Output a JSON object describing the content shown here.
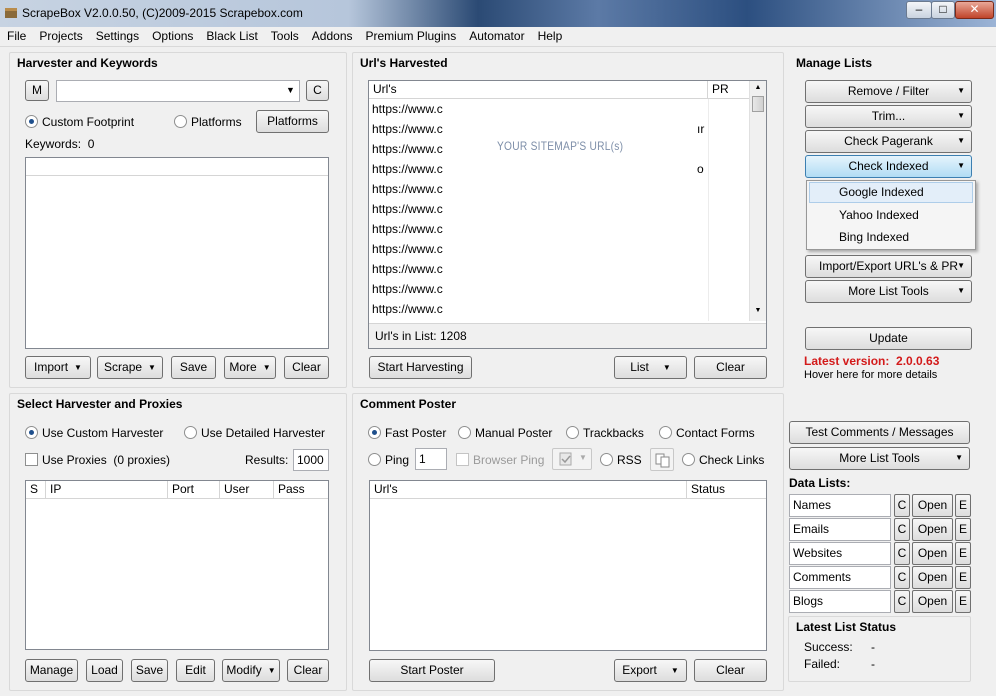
{
  "window": {
    "title": "ScrapeBox V2.0.0.50, (C)2009-2015 Scrapebox.com",
    "minimize": "–",
    "maximize": "□",
    "close": "✕"
  },
  "menu": [
    "File",
    "Projects",
    "Settings",
    "Options",
    "Black List",
    "Tools",
    "Addons",
    "Premium Plugins",
    "Automator",
    "Help"
  ],
  "harvester": {
    "title": "Harvester and Keywords",
    "m_button": "M",
    "c_button": "C",
    "footprint_value": "",
    "custom_footprint_label": "Custom Footprint",
    "platforms_radio_label": "Platforms",
    "platforms_button": "Platforms",
    "keywords_label": "Keywords:",
    "keywords_count": "0",
    "buttons": {
      "import": "Import",
      "scrape": "Scrape",
      "save": "Save",
      "more": "More",
      "clear": "Clear"
    }
  },
  "urls": {
    "title": "Url's Harvested",
    "col_url": "Url's",
    "col_pr": "PR",
    "rows": [
      "https://www.c",
      "https://www.c",
      "https://www.c",
      "https://www.c",
      "https://www.c",
      "https://www.c",
      "https://www.c",
      "https://www.c",
      "https://www.c",
      "https://www.c",
      "https://www.c"
    ],
    "row_tails": [
      "",
      "ır",
      "",
      "o",
      "",
      "",
      "",
      "",
      "",
      "",
      ""
    ],
    "overlay_text": "YOUR SITEMAP'S URL(s)",
    "count_label": "Url's in List:",
    "count": "1208",
    "buttons": {
      "start": "Start Harvesting",
      "list": "List",
      "clear": "Clear"
    }
  },
  "manage": {
    "title": "Manage Lists",
    "buttons": [
      "Remove / Filter",
      "Trim...",
      "Check Pagerank",
      "Check Indexed"
    ],
    "dropdown": [
      "Google Indexed",
      "Yahoo Indexed",
      "Bing Indexed"
    ],
    "import_export": "Import/Export URL's & PR",
    "more_tools": "More List Tools",
    "update": "Update",
    "latest_version_label": "Latest version:",
    "latest_version": "2.0.0.63",
    "hover_text": "Hover here for more details"
  },
  "proxies": {
    "title": "Select Harvester and Proxies",
    "custom_harvester": "Use Custom Harvester",
    "detailed_harvester": "Use Detailed Harvester",
    "use_proxies": "Use Proxies",
    "proxies_count": "(0 proxies)",
    "results_label": "Results:",
    "results_value": "1000",
    "columns": [
      "S",
      "IP",
      "Port",
      "User",
      "Pass"
    ],
    "buttons": {
      "manage": "Manage",
      "load": "Load",
      "save": "Save",
      "edit": "Edit",
      "modify": "Modify",
      "clear": "Clear"
    }
  },
  "poster": {
    "title": "Comment Poster",
    "fast": "Fast Poster",
    "manual": "Manual Poster",
    "trackbacks": "Trackbacks",
    "contact": "Contact Forms",
    "ping": "Ping",
    "ping_value": "1",
    "browser_ping": "Browser Ping",
    "rss": "RSS",
    "check_links": "Check Links",
    "col_url": "Url's",
    "col_status": "Status",
    "buttons": {
      "start": "Start Poster",
      "export": "Export",
      "clear": "Clear"
    }
  },
  "datalists": {
    "test_button": "Test Comments / Messages",
    "more_tools": "More List Tools",
    "title": "Data Lists:",
    "items": [
      "Names",
      "Emails",
      "Websites",
      "Comments",
      "Blogs"
    ],
    "c": "C",
    "open": "Open",
    "e": "E"
  },
  "status": {
    "title": "Latest List Status",
    "success_label": "Success:",
    "success_value": "-",
    "failed_label": "Failed:",
    "failed_value": "-"
  }
}
